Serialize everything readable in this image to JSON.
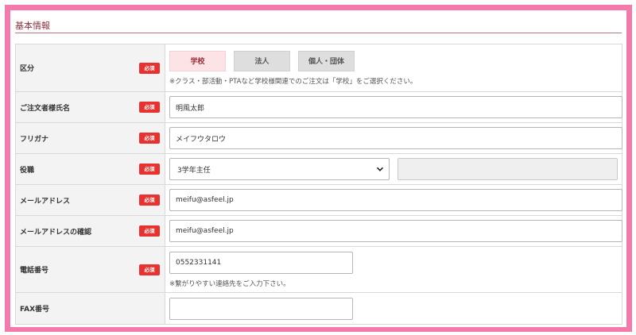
{
  "section": {
    "title": "基本情報"
  },
  "required_badge": "必須",
  "rows": {
    "category": {
      "label": "区分",
      "options": [
        "学校",
        "法人",
        "個人・団体"
      ],
      "selected": "学校",
      "note": "※クラス・部活動・PTAなど学校様関連でのご注文は「学校」をご選択ください。"
    },
    "name": {
      "label": "ご注文者様氏名",
      "value": "明風太郎"
    },
    "kana": {
      "label": "フリガナ",
      "value": "メイフウタロウ"
    },
    "position": {
      "label": "役職",
      "selected": "3学年主任",
      "other_value": ""
    },
    "email": {
      "label": "メールアドレス",
      "value": "meifu@asfeel.jp"
    },
    "email_confirm": {
      "label": "メールアドレスの確認",
      "value": "meifu@asfeel.jp"
    },
    "phone": {
      "label": "電話番号",
      "value": "0552331141",
      "note": "※繋がりやすい連絡先をご入力下さい。"
    },
    "fax": {
      "label": "FAX番号",
      "value": ""
    }
  },
  "colors": {
    "frame": "#f47aac",
    "section_title": "#8a2f3b",
    "badge": "#e8322f",
    "active_tab_bg": "#fbe3e6"
  },
  "icons": {
    "select_arrow": "chevron-down-icon"
  }
}
